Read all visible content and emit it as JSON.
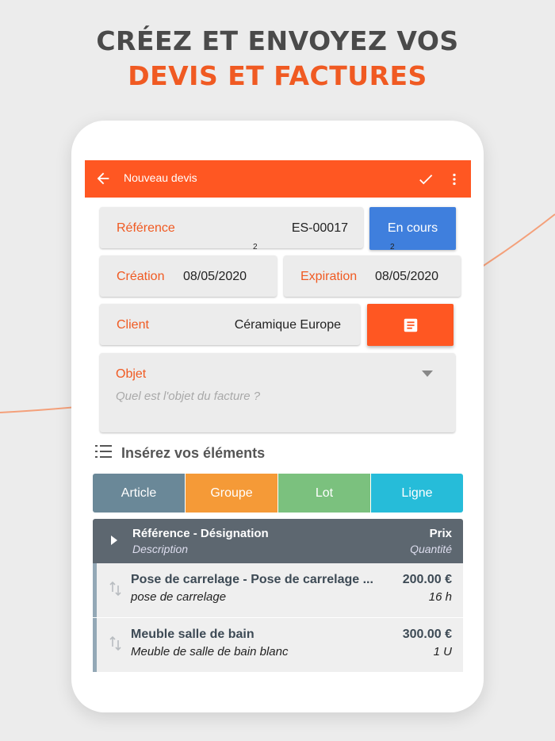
{
  "headline": {
    "line1": "CRÉEZ ET ENVOYEZ VOS",
    "line2": "DEVIS ET FACTURES"
  },
  "appbar": {
    "title": "Nouveau devis",
    "icons": [
      "back-arrow-icon",
      "check-icon",
      "more-vert-icon"
    ]
  },
  "form": {
    "reference": {
      "label": "Référence",
      "value": "ES-00017"
    },
    "status_button": "En cours",
    "badge_left": "2",
    "badge_right": "2",
    "creation": {
      "label": "Création",
      "value": "08/05/2020"
    },
    "expiration": {
      "label": "Expiration",
      "value": "08/05/2020"
    },
    "client": {
      "label": "Client",
      "value": "Céramique Europe"
    },
    "objet": {
      "label": "Objet",
      "placeholder": "Quel est l'objet du facture ?"
    }
  },
  "section": {
    "title": "Insérez vos éléments"
  },
  "tabs": [
    {
      "label": "Article",
      "color": "#6a8898"
    },
    {
      "label": "Groupe",
      "color": "#f59a37"
    },
    {
      "label": "Lot",
      "color": "#7bc17e"
    },
    {
      "label": "Ligne",
      "color": "#26bcd9"
    }
  ],
  "table": {
    "header": {
      "col1": "Référence - Désignation",
      "col1_sub": "Description",
      "col2": "Prix",
      "col2_sub": "Quantité"
    },
    "rows": [
      {
        "name": "Pose de carrelage  -  Pose de carrelage ...",
        "desc": "pose de carrelage",
        "price": "200.00 €",
        "qty": "16 h"
      },
      {
        "name": "Meuble salle de bain",
        "desc": "Meuble de salle de bain blanc",
        "price": "300.00 €",
        "qty": "1 U"
      }
    ]
  },
  "colors": {
    "accent": "#ff5722",
    "status_blue": "#3f7fdd",
    "header_gray": "#5d6770"
  }
}
